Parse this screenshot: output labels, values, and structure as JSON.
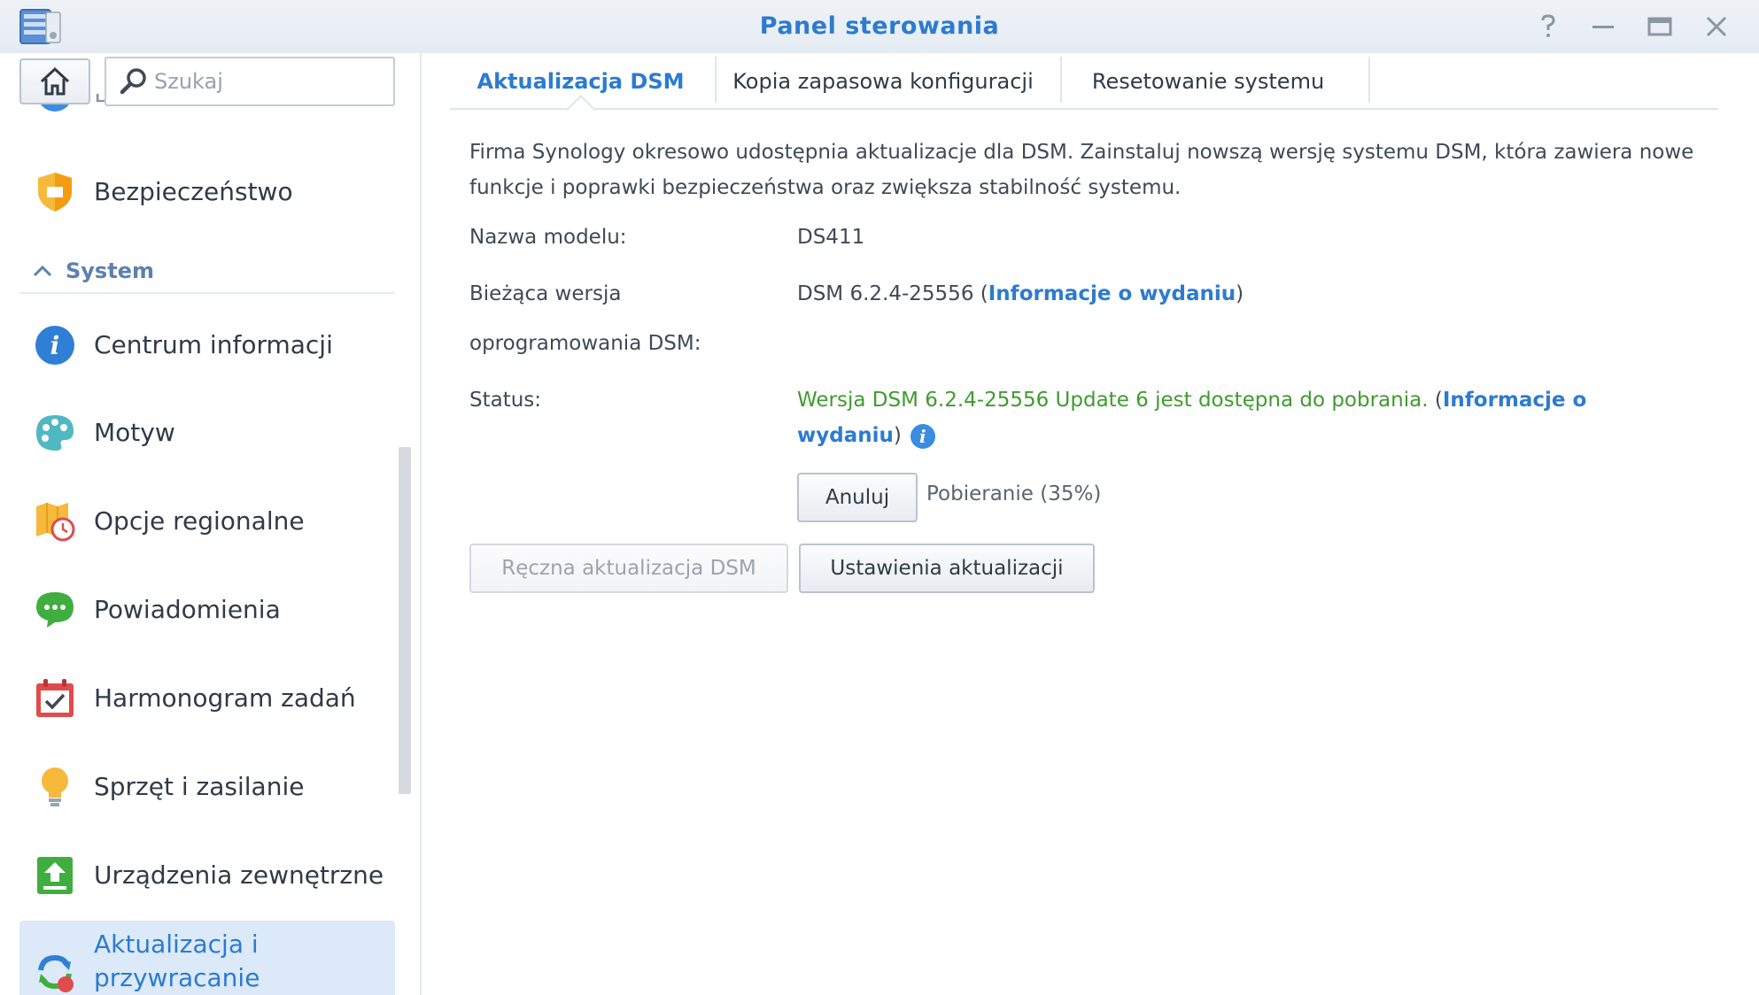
{
  "window": {
    "title": "Panel sterowania",
    "controls": [
      "help-icon",
      "minimize-icon",
      "maximize-icon",
      "close-icon"
    ]
  },
  "sidebar": {
    "search_placeholder": "Szukaj",
    "top_partial_label": "DHCP Server",
    "items_before_section": [
      {
        "label": "Bezpieczeństwo",
        "icon": "shield-icon"
      }
    ],
    "section_title": "System",
    "items": [
      {
        "label": "Centrum informacji",
        "icon": "info-icon"
      },
      {
        "label": "Motyw",
        "icon": "palette-icon"
      },
      {
        "label": "Opcje regionalne",
        "icon": "map-clock-icon"
      },
      {
        "label": "Powiadomienia",
        "icon": "chat-bubble-icon"
      },
      {
        "label": "Harmonogram zadań",
        "icon": "calendar-icon"
      },
      {
        "label": "Sprzęt i zasilanie",
        "icon": "lightbulb-icon"
      },
      {
        "label": "Urządzenia zewnętrzne",
        "icon": "upload-icon"
      },
      {
        "label": "Aktualizacja i przywracanie",
        "icon": "refresh-icon",
        "active": true
      }
    ]
  },
  "tabs": [
    {
      "label": "Aktualizacja DSM",
      "active": true
    },
    {
      "label": "Kopia zapasowa konfiguracji",
      "active": false
    },
    {
      "label": "Resetowanie systemu",
      "active": false
    }
  ],
  "content": {
    "description": "Firma Synology okresowo udostępnia aktualizacje dla DSM. Zainstaluj nowszą wersję systemu DSM, która zawiera nowe funkcje i poprawki bezpieczeństwa oraz zwiększa stabilność systemu.",
    "model_label": "Nazwa modelu:",
    "model_value": "DS411",
    "version_label_line1": "Bieżąca wersja",
    "version_label_line2": "oprogramowania DSM:",
    "version_value": "DSM 6.2.4-25556",
    "version_link": "Informacje o wydaniu",
    "status_label": "Status:",
    "status_text": "Wersja DSM 6.2.4-25556 Update 6 jest dostępna do pobrania.",
    "status_link_line1": "Informacje o",
    "status_link_line2": "wydaniu",
    "cancel_button": "Anuluj",
    "download_label": "Pobieranie",
    "download_progress_percent": 35,
    "download_progress_text": "Pobieranie (35%)",
    "manual_update_button": "Ręczna aktualizacja DSM",
    "update_settings_button": "Ustawienia aktualizacji"
  },
  "colors": {
    "accent": "#2c7bd0",
    "status_green": "#3f9b2e",
    "active_bg": "#dbe9f8"
  }
}
